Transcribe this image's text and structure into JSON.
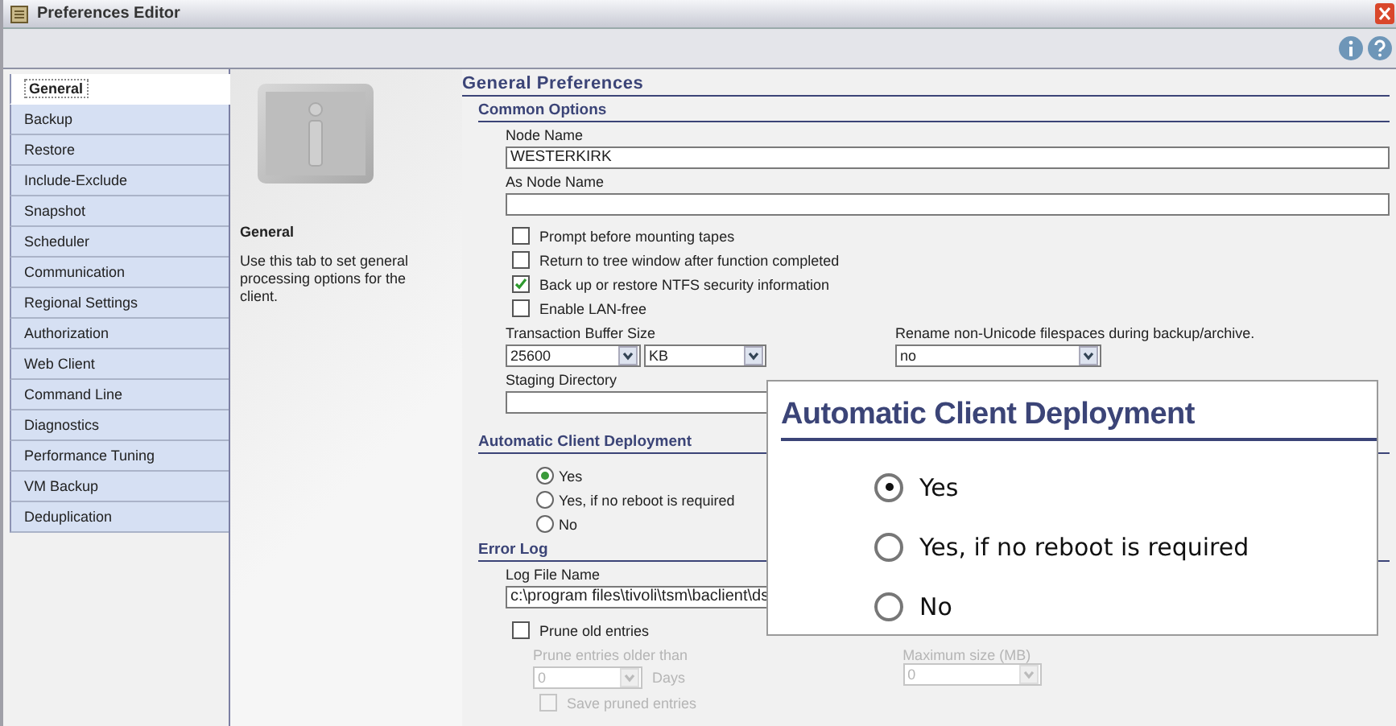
{
  "window": {
    "title": "Preferences Editor"
  },
  "tabs": [
    {
      "label": "General",
      "selected": true
    },
    {
      "label": "Backup",
      "selected": false
    },
    {
      "label": "Restore",
      "selected": false
    },
    {
      "label": "Include-Exclude",
      "selected": false
    },
    {
      "label": "Snapshot",
      "selected": false
    },
    {
      "label": "Scheduler",
      "selected": false
    },
    {
      "label": "Communication",
      "selected": false
    },
    {
      "label": "Regional Settings",
      "selected": false
    },
    {
      "label": "Authorization",
      "selected": false
    },
    {
      "label": "Web Client",
      "selected": false
    },
    {
      "label": "Command Line",
      "selected": false
    },
    {
      "label": "Diagnostics",
      "selected": false
    },
    {
      "label": "Performance Tuning",
      "selected": false
    },
    {
      "label": "VM Backup",
      "selected": false
    },
    {
      "label": "Deduplication",
      "selected": false
    }
  ],
  "description": {
    "title": "General",
    "text": "Use this tab to set general processing options for the client."
  },
  "content": {
    "heading": "General Preferences",
    "common_options": {
      "heading": "Common Options",
      "node_name": {
        "label": "Node Name",
        "value": "WESTERKIRK"
      },
      "as_node_name": {
        "label": "As Node Name"
      },
      "checkboxes": [
        {
          "label": "Prompt before mounting tapes",
          "checked": false
        },
        {
          "label": "Return to tree window after function completed",
          "checked": false
        },
        {
          "label": "Back up or restore NTFS security information",
          "checked": true
        },
        {
          "label": "Enable LAN-free",
          "checked": false
        }
      ],
      "transaction_buffer": {
        "label": "Transaction Buffer Size",
        "value": "25600",
        "unit": "KB"
      },
      "rename": {
        "label": "Rename non-Unicode filespaces during backup/archive.",
        "value": "no"
      },
      "staging": {
        "label": "Staging Directory"
      }
    },
    "deployment": {
      "heading": "Automatic Client Deployment",
      "options": [
        {
          "label": "Yes",
          "selected": true
        },
        {
          "label": "Yes, if no reboot is required",
          "selected": false
        },
        {
          "label": "No",
          "selected": false
        }
      ]
    },
    "error_log": {
      "heading": "Error Log",
      "log_file": {
        "label": "Log File Name",
        "value": "c:\\program files\\tivoli\\tsm\\baclient\\ds"
      },
      "prune": {
        "label": "Prune old entries",
        "checked": false
      },
      "prune_older": {
        "label": "Prune entries older than",
        "value": "0",
        "unit": "Days",
        "disabled": true
      },
      "save_pruned": {
        "label": "Save pruned entries",
        "checked": false,
        "disabled": true
      },
      "max_size": {
        "label": "Maximum size (MB)",
        "value": "0",
        "disabled": true
      }
    }
  },
  "callout": {
    "heading": "Automatic Client Deployment",
    "options": [
      {
        "label": "Yes",
        "selected": true
      },
      {
        "label": "Yes, if no reboot is required",
        "selected": false
      },
      {
        "label": "No",
        "selected": false
      }
    ]
  }
}
